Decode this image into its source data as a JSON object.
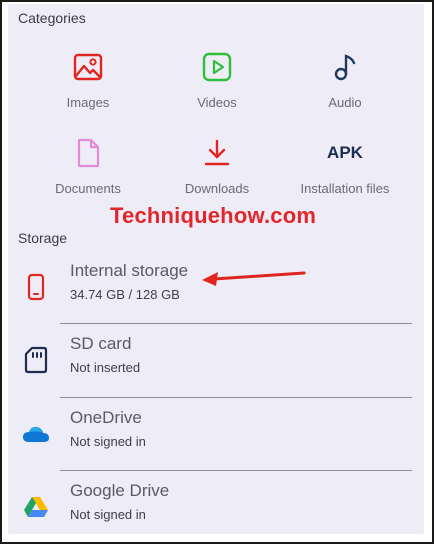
{
  "categories": {
    "title": "Categories",
    "items": [
      {
        "label": "Images",
        "icon": "image-icon",
        "color": "#e0261f"
      },
      {
        "label": "Videos",
        "icon": "video-icon",
        "color": "#2fbf3a"
      },
      {
        "label": "Audio",
        "icon": "music-note-icon",
        "color": "#1e3a5f"
      },
      {
        "label": "Documents",
        "icon": "document-icon",
        "color": "#e48ad6"
      },
      {
        "label": "Downloads",
        "icon": "download-icon",
        "color": "#e0261f"
      },
      {
        "label": "Installation files",
        "icon": "apk-icon",
        "icon_text": "APK",
        "color": "#1e2d4f"
      }
    ]
  },
  "watermark": "Techniquehow.com",
  "storage": {
    "title": "Storage",
    "items": [
      {
        "title": "Internal storage",
        "subtitle": "34.74 GB / 128 GB",
        "icon": "phone-icon",
        "color": "#e0261f"
      },
      {
        "title": "SD card",
        "subtitle": "Not inserted",
        "icon": "sd-card-icon",
        "color": "#1e2d4f"
      },
      {
        "title": "OneDrive",
        "subtitle": "Not signed in",
        "icon": "onedrive-icon",
        "color": "#0f78d4"
      },
      {
        "title": "Google Drive",
        "subtitle": "Not signed in",
        "icon": "google-drive-icon",
        "color": "#1fa463"
      }
    ]
  },
  "annotation_color": "#e0261f"
}
